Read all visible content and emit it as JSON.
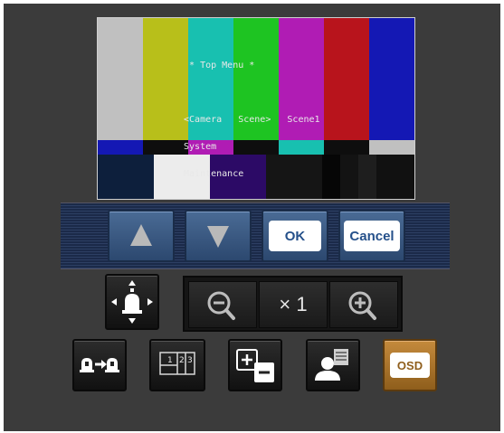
{
  "preview": {
    "osd_lines": [
      "  * Top Menu *",
      "",
      " <Camera   Scene>   Scene1",
      " System",
      " Maintenance"
    ]
  },
  "controls": {
    "up_arrow_icon": "up-arrow-icon",
    "down_arrow_icon": "down-arrow-icon",
    "ok_label": "OK",
    "cancel_label": "Cancel"
  },
  "zoom": {
    "value": "× 1"
  },
  "toolbar": {
    "multi_screen_digits": [
      "1",
      "2",
      "3"
    ],
    "osd_label": "OSD"
  },
  "colors": {
    "panel_bg": "#3b3b3b",
    "strip_bg": "#1b2a49",
    "button_blue": "#3a5a84",
    "osd_button": "#b07a30",
    "ok_text": "#25508a",
    "cancel_text": "#25508a"
  }
}
